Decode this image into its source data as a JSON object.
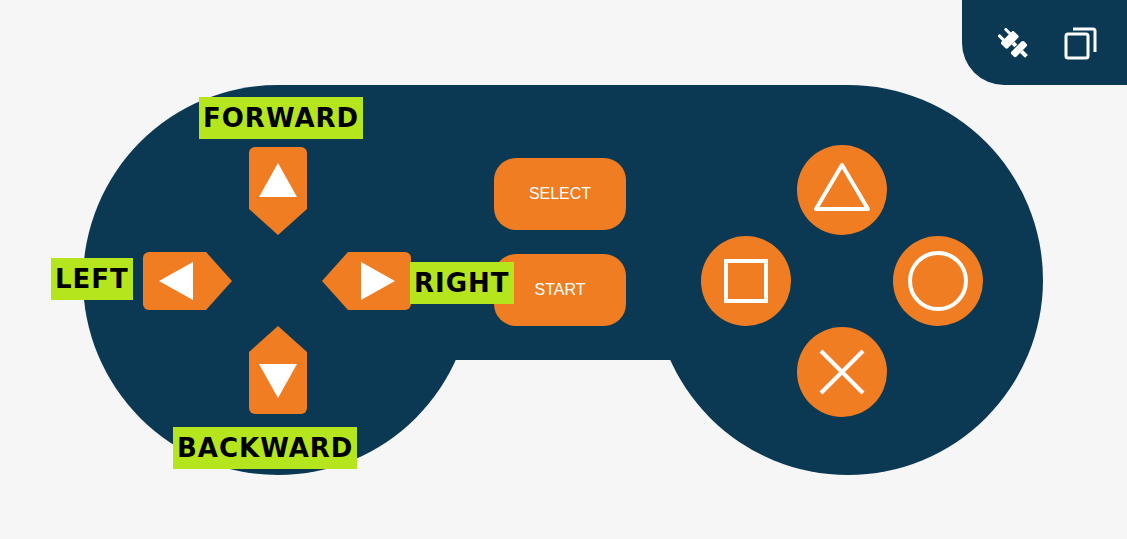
{
  "dpad": [
    {
      "kind": "up",
      "label": "FORWARD"
    },
    {
      "kind": "left",
      "label": "LEFT"
    },
    {
      "kind": "right",
      "label": "RIGHT"
    },
    {
      "kind": "down",
      "label": "BACKWARD"
    }
  ],
  "buttons": [
    "SELECT",
    "START"
  ],
  "face_buttons": [
    {
      "kind": "triangle"
    },
    {
      "kind": "square"
    },
    {
      "kind": "circle"
    },
    {
      "kind": "cross"
    }
  ]
}
